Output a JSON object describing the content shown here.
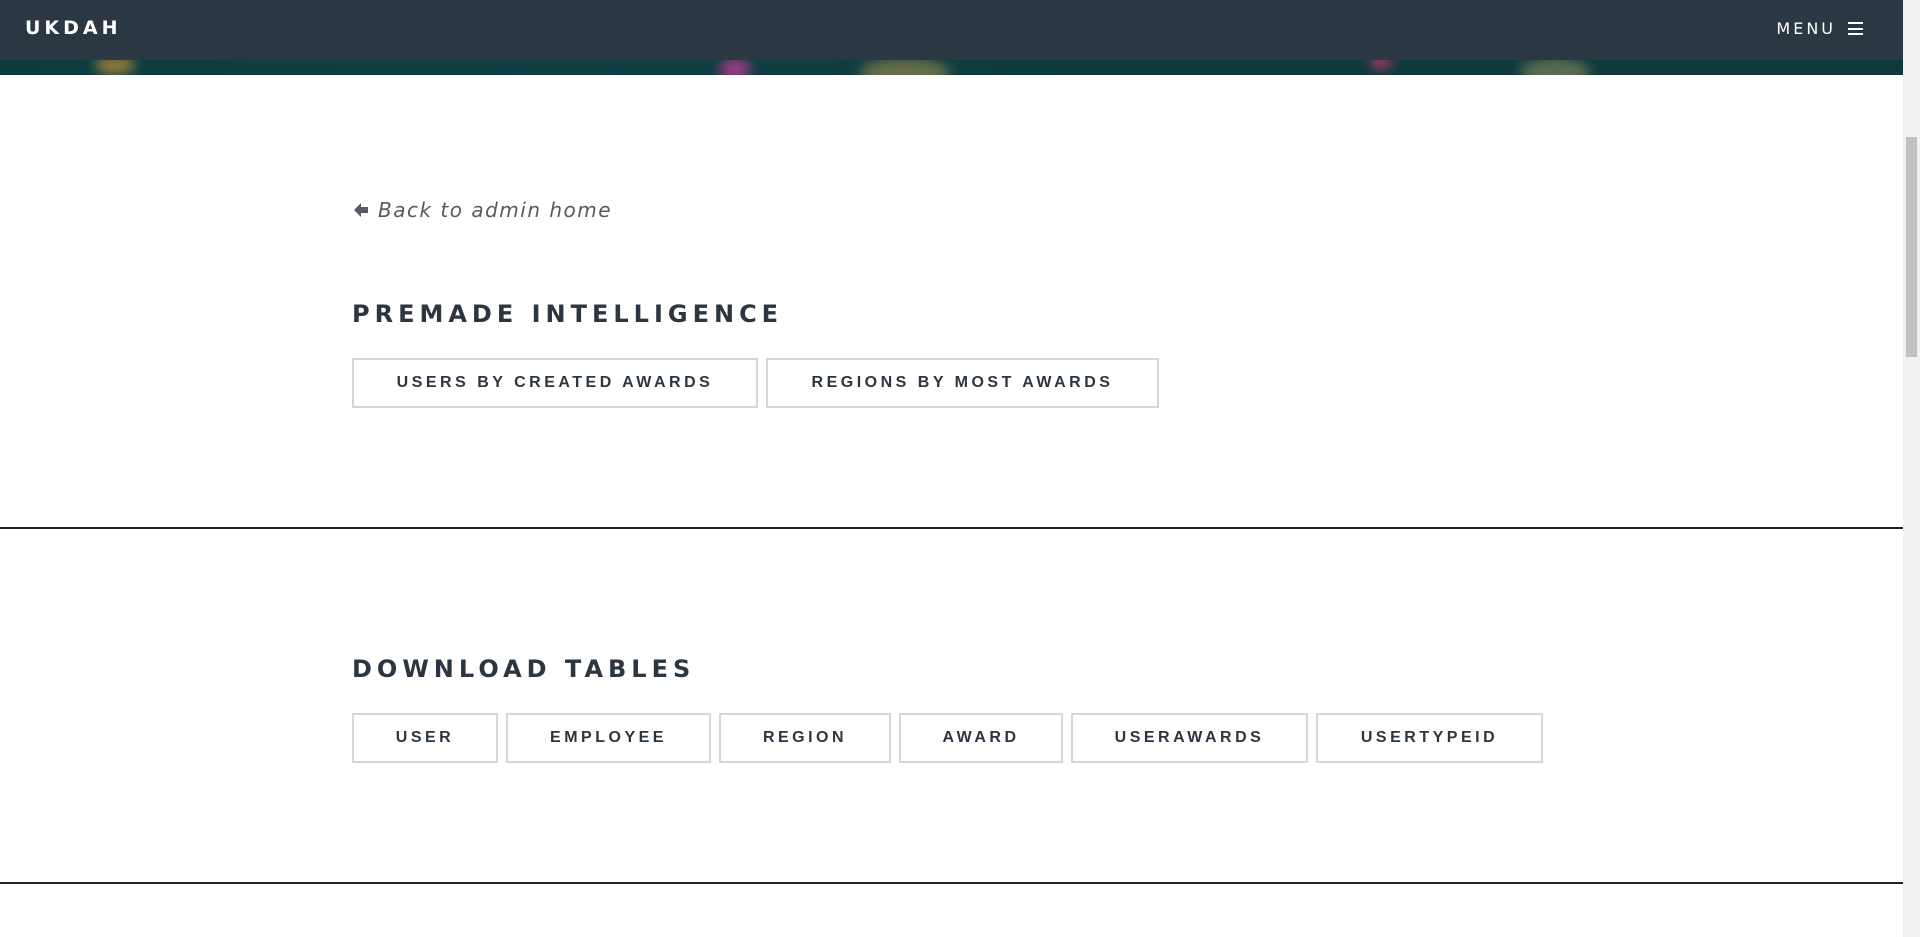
{
  "navbar": {
    "brand": "UKDAH",
    "menu_label": "MENU"
  },
  "back_link": {
    "label": "Back to admin home"
  },
  "premade_intelligence": {
    "title": "PREMADE INTELLIGENCE",
    "buttons": [
      "USERS BY CREATED AWARDS",
      "REGIONS BY MOST AWARDS"
    ]
  },
  "download_tables": {
    "title": "DOWNLOAD TABLES",
    "buttons": [
      "USER",
      "EMPLOYEE",
      "REGION",
      "AWARD",
      "USERAWARDS",
      "USERTYPEID"
    ]
  },
  "colors": {
    "navbar_bg": "#2c3844",
    "text_dark": "#2c3640",
    "button_border": "#d6d6d6",
    "divider": "#222222"
  },
  "icons": {
    "back": "arrow-left-icon",
    "menu": "hamburger-icon"
  }
}
